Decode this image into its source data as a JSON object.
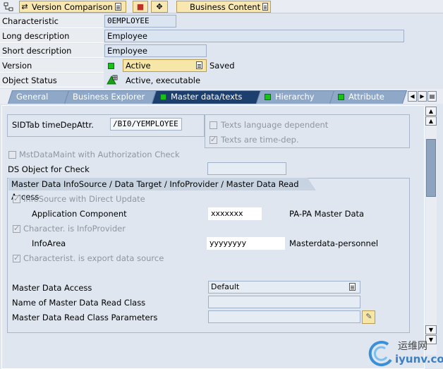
{
  "toolbar": {
    "version_comparison": "Version Comparison",
    "business_content": "Business Content"
  },
  "header": {
    "characteristic_label": "Characteristic",
    "characteristic_value": "0EMPLOYEE",
    "long_desc_label": "Long description",
    "long_desc_value": "Employee",
    "short_desc_label": "Short description",
    "short_desc_value": "Employee",
    "version_label": "Version",
    "version_value": "Active",
    "version_status": "Saved",
    "object_status_label": "Object Status",
    "object_status_value": "Active, executable"
  },
  "tabs": [
    {
      "label": "General"
    },
    {
      "label": "Business Explorer"
    },
    {
      "label": "Master data/texts"
    },
    {
      "label": "Hierarchy"
    },
    {
      "label": "Attribute"
    }
  ],
  "panel": {
    "sidtab_label": "SIDTab timeDepAttr.",
    "sidtab_value": "/BI0/YEMPLOYEE",
    "texts_lang_dep": "Texts language dependent",
    "texts_time_dep": "Texts are time-dep.",
    "mst_auth_check": "MstDataMaint with Authorization Check",
    "ds_object_label": "DS Object for Check",
    "section_title": "Master Data InfoSource / Data Target / InfoProvider / Master Data Read Access",
    "infosource_direct": "InfoSource with Direct Update",
    "app_component_label": "Application Component",
    "app_component_value": "xxxxxxx",
    "app_component_desc": "PA-PA Master Data",
    "char_infoprovider": "Character. is InfoProvider",
    "infoarea_label": "InfoArea",
    "infoarea_value": "yyyyyyyy",
    "infoarea_desc": "Masterdata-personnel",
    "export_datasource": "Characterist. is export data source",
    "md_access_label": "Master Data Access",
    "md_access_value": "Default",
    "md_read_class_label": "Name of Master Data Read Class",
    "md_read_params_label": "Master Data Read Class Parameters"
  },
  "watermark": {
    "cn": "运维网",
    "url": "iyunv.com"
  }
}
